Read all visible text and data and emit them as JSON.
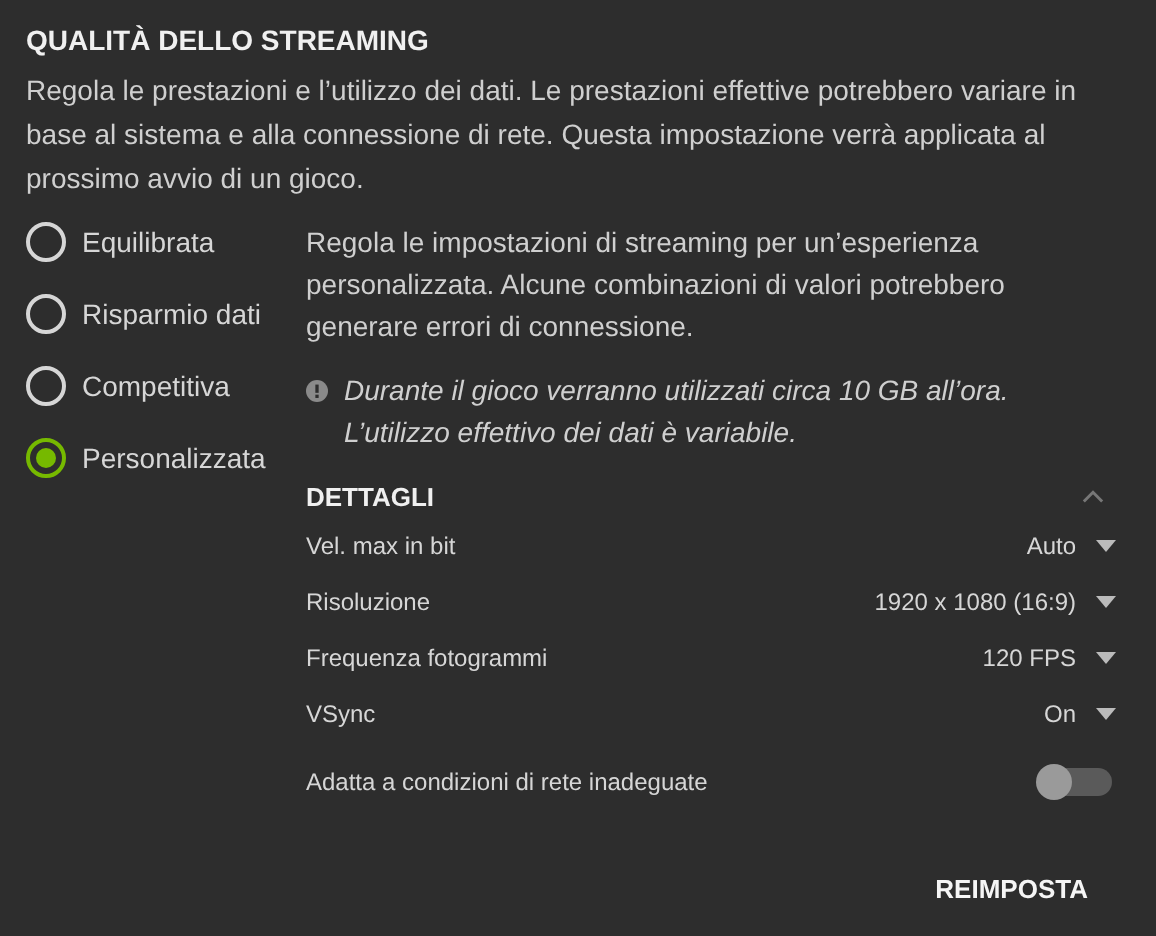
{
  "title": "QUALITÀ DELLO STREAMING",
  "description": "Regola le prestazioni e l’utilizzo dei dati. Le prestazioni effettive potrebbero variare in base al sistema e alla connessione di rete. Questa impostazione verrà applicata al prossimo avvio di un gioco.",
  "presets": [
    {
      "label": "Equilibrata",
      "selected": false
    },
    {
      "label": "Risparmio dati",
      "selected": false
    },
    {
      "label": "Competitiva",
      "selected": false
    },
    {
      "label": "Personalizzata",
      "selected": true
    }
  ],
  "preset_description": "Regola le impostazioni di streaming per un’esperienza personalizzata. Alcune combinazioni di valori potrebbero generare errori di connessione.",
  "notice": "Durante il gioco verranno utilizzati circa 10 GB all’ora. L’utilizzo effettivo dei dati è variabile.",
  "details": {
    "title": "DETTAGLI",
    "expanded": true,
    "settings": [
      {
        "kind": "dropdown",
        "label": "Vel. max in bit",
        "value": "Auto"
      },
      {
        "kind": "dropdown",
        "label": "Risoluzione",
        "value": "1920 x 1080 (16:9)"
      },
      {
        "kind": "dropdown",
        "label": "Frequenza fotogrammi",
        "value": "120 FPS"
      },
      {
        "kind": "dropdown",
        "label": "VSync",
        "value": "On"
      },
      {
        "kind": "toggle",
        "label": "Adatta a condizioni di rete inadeguate",
        "on": false
      }
    ]
  },
  "buttons": [
    "REIMPOSTA"
  ]
}
